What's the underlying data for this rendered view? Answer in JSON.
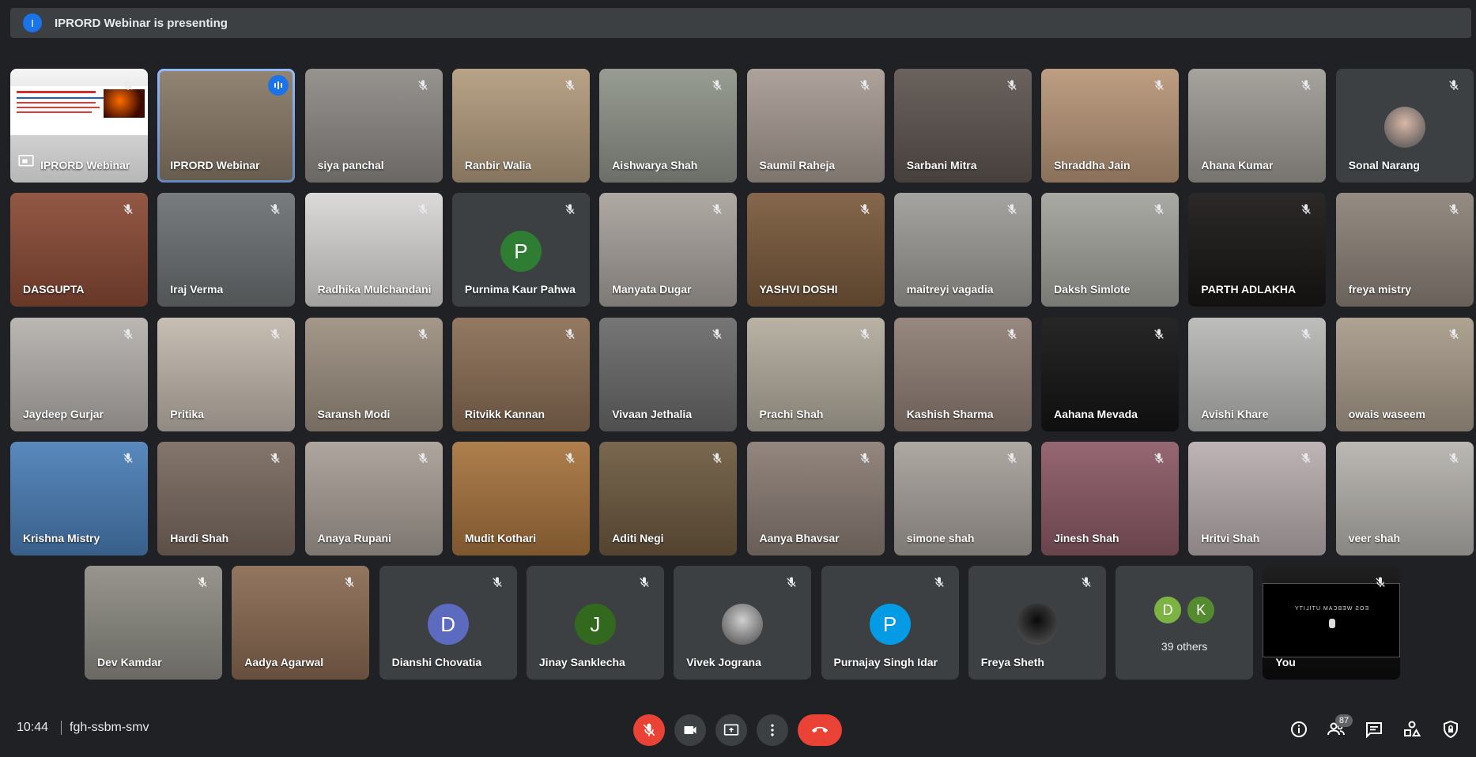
{
  "banner": {
    "avatar_letter": "I",
    "text": "IPRORD Webinar is presenting"
  },
  "rows": [
    [
      {
        "name": "IPRORD Webinar",
        "kind": "presentation",
        "bg": "#f4f4f4",
        "mic": "off"
      },
      {
        "name": "IPRORD Webinar",
        "kind": "video",
        "bg": "#8a7a68",
        "mic": "speaking",
        "active": true
      },
      {
        "name": "siya panchal",
        "kind": "video",
        "bg": "#8e8a86",
        "mic": "off"
      },
      {
        "name": "Ranbir Walia",
        "kind": "video",
        "bg": "#b39c7e",
        "mic": "off"
      },
      {
        "name": "Aishwarya Shah",
        "kind": "video",
        "bg": "#8f948a",
        "mic": "off"
      },
      {
        "name": "Saumil Raheja",
        "kind": "video",
        "bg": "#a79b93",
        "mic": "off"
      },
      {
        "name": "Sarbani Mitra",
        "kind": "video",
        "bg": "#5e5550",
        "mic": "off"
      },
      {
        "name": "Shraddha Jain",
        "kind": "video",
        "bg": "#b89678",
        "mic": "off"
      },
      {
        "name": "Ahana Kumar",
        "kind": "video",
        "bg": "#9f9b95",
        "mic": "off"
      },
      {
        "name": "Sonal Narang",
        "kind": "photo",
        "avatar_color": "#d9b8a8",
        "mic": "off"
      }
    ],
    [
      {
        "name": "DASGUPTA",
        "kind": "video",
        "bg": "#8a4a35",
        "mic": "off"
      },
      {
        "name": "Iraj Verma",
        "kind": "video",
        "bg": "#6d7173",
        "mic": "off"
      },
      {
        "name": "Radhika Mulchandani",
        "kind": "video",
        "bg": "#d9d7d5",
        "mic": "off"
      },
      {
        "name": "Purnima Kaur Pahwa",
        "kind": "letter",
        "letter": "P",
        "avatar_color": "#2e7d32",
        "mic": "off"
      },
      {
        "name": "Manyata Dugar",
        "kind": "video",
        "bg": "#a8a29c",
        "mic": "off"
      },
      {
        "name": "YASHVI DOSHI",
        "kind": "video",
        "bg": "#7a5a3c",
        "mic": "off"
      },
      {
        "name": "maitreyi vagadia",
        "kind": "video",
        "bg": "#9d9c98",
        "mic": "off"
      },
      {
        "name": "Daksh Simlote",
        "kind": "video",
        "bg": "#a3a39c",
        "mic": "off"
      },
      {
        "name": "PARTH ADLAKHA",
        "kind": "video",
        "bg": "#1a1616",
        "mic": "off"
      },
      {
        "name": "freya mistry",
        "kind": "video",
        "bg": "#8c8278",
        "mic": "off"
      }
    ],
    [
      {
        "name": "Jaydeep Gurjar",
        "kind": "video",
        "bg": "#b5b1ad",
        "mic": "off"
      },
      {
        "name": "Pritika",
        "kind": "video",
        "bg": "#c2b8ad",
        "mic": "off"
      },
      {
        "name": "Saransh Modi",
        "kind": "video",
        "bg": "#9c8f80",
        "mic": "off"
      },
      {
        "name": "Ritvikk Kannan",
        "kind": "video",
        "bg": "#8a6e55",
        "mic": "off"
      },
      {
        "name": "Vivaan Jethalia",
        "kind": "video",
        "bg": "#6a6a6a",
        "mic": "off"
      },
      {
        "name": "Prachi Shah",
        "kind": "video",
        "bg": "#b3ac9e",
        "mic": "off"
      },
      {
        "name": "Kashish Sharma",
        "kind": "video",
        "bg": "#8f7e74",
        "mic": "off"
      },
      {
        "name": "Aahana Mevada",
        "kind": "video",
        "bg": "#141414",
        "mic": "off"
      },
      {
        "name": "Avishi Khare",
        "kind": "video",
        "bg": "#b8b8b6",
        "mic": "off"
      },
      {
        "name": "owais waseem",
        "kind": "video",
        "bg": "#a89b8a",
        "mic": "off"
      }
    ],
    [
      {
        "name": "Krishna Mistry",
        "kind": "video",
        "bg": "#4b7fb8",
        "mic": "off"
      },
      {
        "name": "Hardi Shah",
        "kind": "video",
        "bg": "#7a6a60",
        "mic": "off"
      },
      {
        "name": "Anaya Rupani",
        "kind": "video",
        "bg": "#a89e96",
        "mic": "off"
      },
      {
        "name": "Mudit Kothari",
        "kind": "video",
        "bg": "#a8743e",
        "mic": "off"
      },
      {
        "name": "Aditi Negi",
        "kind": "video",
        "bg": "#6e5a40",
        "mic": "off"
      },
      {
        "name": "Aanya Bhavsar",
        "kind": "video",
        "bg": "#8a7c74",
        "mic": "off"
      },
      {
        "name": "simone shah",
        "kind": "video",
        "bg": "#a7a19b",
        "mic": "off"
      },
      {
        "name": "Jinesh Shah",
        "kind": "video",
        "bg": "#8c5a66",
        "mic": "off"
      },
      {
        "name": "Hritvi Shah",
        "kind": "video",
        "bg": "#b9aeb0",
        "mic": "off"
      },
      {
        "name": "veer shah",
        "kind": "video",
        "bg": "#b6b3ae",
        "mic": "off"
      }
    ],
    [
      {
        "name": "Dev Kamdar",
        "kind": "video",
        "bg": "#8e8c84",
        "mic": "off"
      },
      {
        "name": "Aadya Agarwal",
        "kind": "video",
        "bg": "#8a6a52",
        "mic": "off"
      },
      {
        "name": "Dianshi Chovatia",
        "kind": "letter",
        "letter": "D",
        "avatar_color": "#5c6bc0",
        "mic": "off"
      },
      {
        "name": "Jinay Sanklecha",
        "kind": "letter",
        "letter": "J",
        "avatar_color": "#33691e",
        "mic": "off"
      },
      {
        "name": "Vivek Jograna",
        "kind": "photo",
        "avatar_color": "#cfcfcf",
        "mic": "off"
      },
      {
        "name": "Purnajay Singh Idar",
        "kind": "letter",
        "letter": "P",
        "avatar_color": "#039be5",
        "mic": "off"
      },
      {
        "name": "Freya Sheth",
        "kind": "photo",
        "avatar_color": "#0a0a0a",
        "mic": "off"
      },
      {
        "name": "39 others",
        "kind": "others",
        "letters": [
          "D",
          "K"
        ],
        "colors": [
          "#7cb342",
          "#558b2f"
        ]
      },
      {
        "name": "You",
        "kind": "self",
        "bg": "#0c0c0c",
        "screen_text": "EOS WEBCAM UTILITY",
        "mic": "off"
      }
    ]
  ],
  "bottom": {
    "time": "10:44",
    "meeting_code": "fgh-ssbm-smv",
    "participants_count": "87"
  }
}
